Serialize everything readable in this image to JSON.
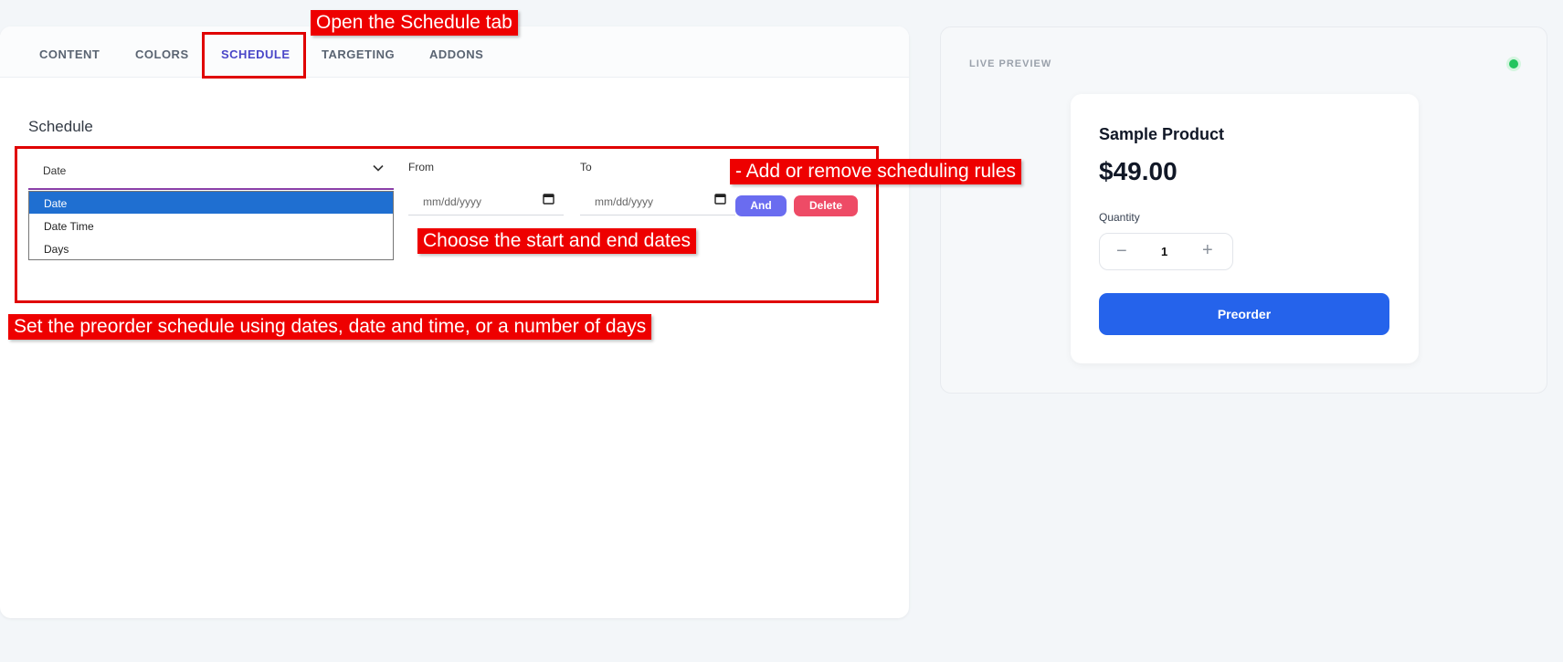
{
  "tabs": [
    {
      "label": "CONTENT"
    },
    {
      "label": "COLORS"
    },
    {
      "label": "SCHEDULE"
    },
    {
      "label": "TARGETING"
    },
    {
      "label": "ADDONS"
    }
  ],
  "active_tab": "SCHEDULE",
  "schedule": {
    "title": "Schedule",
    "type_select": {
      "value": "Date",
      "options": [
        "Date",
        "Date Time",
        "Days"
      ]
    },
    "from_label": "From",
    "to_label": "To",
    "from_placeholder": "mm/dd/yyyy",
    "to_placeholder": "mm/dd/yyyy",
    "and_button": "And",
    "delete_button": "Delete"
  },
  "preview": {
    "label": "LIVE PREVIEW",
    "product_name": "Sample Product",
    "price": "$49.00",
    "quantity_label": "Quantity",
    "quantity_value": "1",
    "minus": "−",
    "plus": "+",
    "preorder_button": "Preorder"
  },
  "annotations": {
    "open_schedule_tab": "Open the Schedule tab",
    "add_remove_rules": "- Add or remove scheduling rules",
    "choose_dates": "Choose the start and end dates",
    "set_schedule": "Set the preorder schedule using dates, date and time, or a number of days"
  },
  "colors": {
    "accent": "#4a46c8",
    "and_button": "#6a6cf0",
    "delete_button": "#ee4b66",
    "preorder_button": "#2563eb",
    "live_dot": "#22c55e",
    "annotation": "#ee0000"
  }
}
